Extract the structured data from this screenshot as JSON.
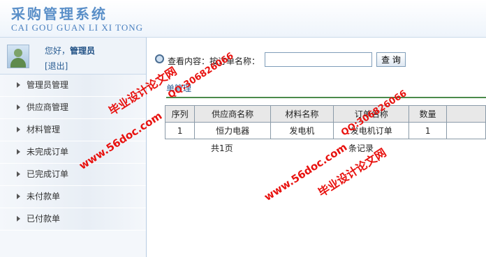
{
  "header": {
    "title_cn": "采购管理系统",
    "title_en": "CAI GOU GUAN LI XI TONG"
  },
  "user": {
    "greeting": "您好，",
    "role": "管理员",
    "logout": "[退出]"
  },
  "sidebar": {
    "items": [
      {
        "label": "管理员管理"
      },
      {
        "label": "供应商管理"
      },
      {
        "label": "材料管理"
      },
      {
        "label": "未完成订单"
      },
      {
        "label": "已完成订单"
      },
      {
        "label": "未付款单"
      },
      {
        "label": "已付款单"
      }
    ]
  },
  "search": {
    "label": "查看内容：按订单名称：",
    "value": "",
    "button": "查 询"
  },
  "section": {
    "title": "单管理"
  },
  "table": {
    "columns": [
      "序列",
      "供应商名称",
      "材料名称",
      "订单名称",
      "数量",
      ""
    ],
    "rows": [
      [
        "1",
        "恒力电器",
        "发电机",
        "发电机订单",
        "1",
        ""
      ]
    ]
  },
  "pager": {
    "left": "共1页",
    "right": "条记录"
  },
  "watermarks": {
    "w1": "毕业设计论文网",
    "w2": "QQ:306826066",
    "w3": "www.56doc.com",
    "w4": "QQ:306826066",
    "w5": "www.56doc.com",
    "w6": "毕业设计论文网"
  },
  "colors": {
    "watermark": "#e8120f",
    "accent": "#2a5d93",
    "rule": "#4a8a4a"
  }
}
